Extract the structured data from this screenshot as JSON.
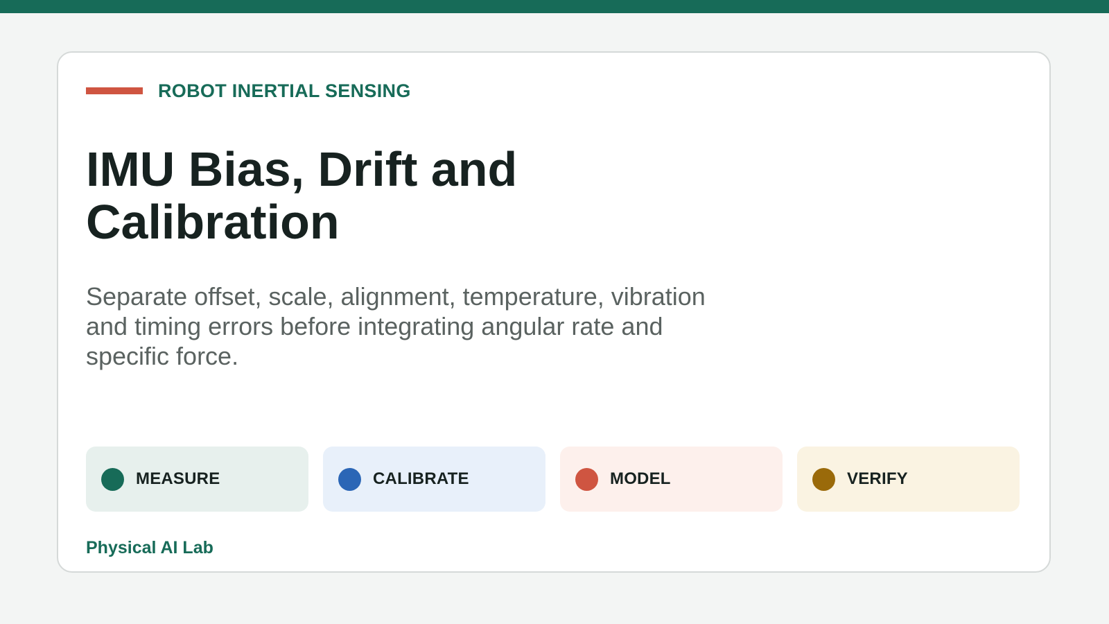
{
  "colors": {
    "brand": "#176b58",
    "accent": "#cf5541",
    "page_bg": "#f3f5f4"
  },
  "eyebrow": {
    "text": "ROBOT INERTIAL SENSING"
  },
  "title": "IMU Bias, Drift and Calibration",
  "subtitle": "Separate offset, scale, alignment, temperature, vibration and timing errors before integrating angular rate and specific force.",
  "steps": [
    {
      "label": "MEASURE",
      "dot_color": "#176b58",
      "bg_color": "#e7f0ed",
      "icon": "green-dot-icon"
    },
    {
      "label": "CALIBRATE",
      "dot_color": "#2b66b6",
      "bg_color": "#e8f0fa",
      "icon": "blue-dot-icon"
    },
    {
      "label": "MODEL",
      "dot_color": "#cf5541",
      "bg_color": "#fdf0ec",
      "icon": "red-dot-icon"
    },
    {
      "label": "VERIFY",
      "dot_color": "#9a6a0a",
      "bg_color": "#faf3e2",
      "icon": "gold-dot-icon"
    }
  ],
  "footer": {
    "text": "Physical AI Lab"
  }
}
